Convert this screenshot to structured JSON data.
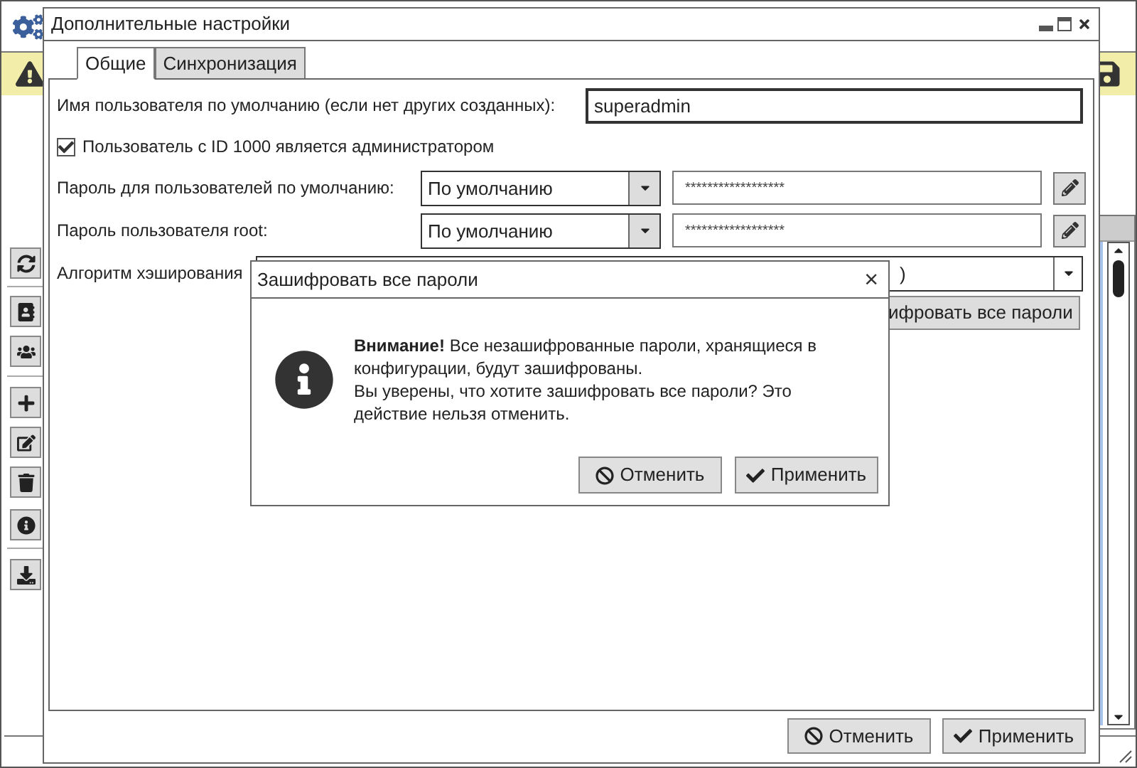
{
  "dialog": {
    "title": "Дополнительные настройки",
    "tabs": [
      {
        "label": "Общие",
        "selected": true
      },
      {
        "label": "Синхронизация",
        "selected": false
      }
    ],
    "fields": [
      {
        "kind": "text",
        "label": "Имя пользователя по умолчанию (если нет других созданных):",
        "value": "superadmin"
      },
      {
        "kind": "checkbox",
        "label": "Пользователь с ID 1000 является администратором",
        "checked": true
      },
      {
        "kind": "password",
        "label": "Пароль для пользователей по умолчанию:",
        "select": "По умолчанию",
        "value": "******************"
      },
      {
        "kind": "password",
        "label": "Пароль пользователя root:",
        "select": "По умолчанию",
        "value": "******************"
      },
      {
        "kind": "select",
        "label": "Алгоритм хэширования",
        "select": ")"
      }
    ],
    "action_button": "ифровать все пароли",
    "buttons": [
      {
        "kind": "cancel",
        "label": "Отменить"
      },
      {
        "kind": "apply",
        "label": "Применить"
      }
    ]
  },
  "modal": {
    "title": "Зашифровать все пароли",
    "close": "×",
    "message": [
      "**Внимание!** Все незашифрованные пароли, хранящиеся в конфигурации, будут зашифрованы.",
      "Вы уверены, что хотите зашифровать все пароли? Это действие нельзя отменить."
    ],
    "buttons": [
      {
        "kind": "cancel",
        "label": "Отменить"
      },
      {
        "kind": "apply",
        "label": "Применить"
      }
    ]
  }
}
